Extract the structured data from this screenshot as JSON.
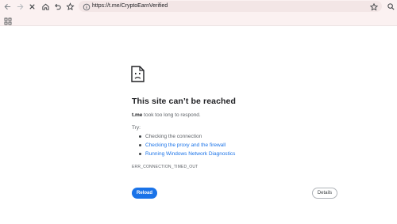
{
  "toolbar": {
    "back_icon": "back-arrow-icon",
    "forward_icon": "forward-arrow-icon",
    "stop_icon": "stop-x-icon",
    "home_icon": "home-icon",
    "undo_icon": "undo-icon",
    "bookmark_icon": "star-icon",
    "url": "https://t.me/CryptoEarnVerified",
    "site_info_icon": "info-icon",
    "bookmark_page_icon": "star-icon",
    "search_icon": "search-icon"
  },
  "bookmarks_bar": {
    "apps_icon": "apps-grid-icon"
  },
  "error_page": {
    "icon": "sad-document-icon",
    "headline": "This site can’t be reached",
    "host": "t.me",
    "message": " took too long to respond.",
    "try_label": "Try:",
    "suggestions": [
      {
        "label": "Checking the connection",
        "is_link": false
      },
      {
        "label": "Checking the proxy and the firewall",
        "is_link": true
      },
      {
        "label": "Running Windows Network Diagnostics",
        "is_link": true
      }
    ],
    "error_code": "ERR_CONNECTION_TIMED_OUT",
    "reload_label": "Reload",
    "details_label": "Details"
  },
  "colors": {
    "toolbar_bg": "#fbf1f1",
    "omnibox_bg": "#f3e6e6",
    "link": "#1a73e8",
    "primary_button": "#1a73e8"
  }
}
